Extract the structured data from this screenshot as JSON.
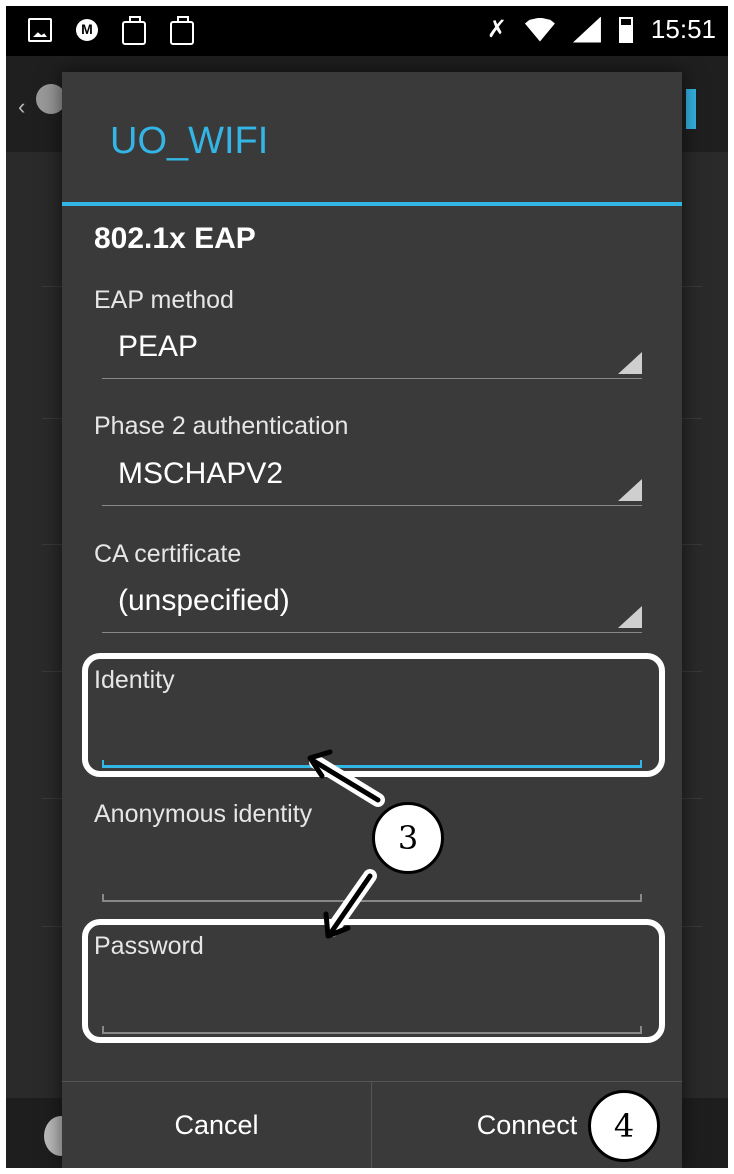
{
  "status_bar": {
    "time": "15:51",
    "left_icons": [
      "picture-icon",
      "motorola-icon",
      "briefcase-check-icon",
      "briefcase-icon"
    ],
    "right_icons": [
      "mute-icon",
      "wifi-icon",
      "signal-icon",
      "battery-icon"
    ]
  },
  "dialog": {
    "title": "UO_WIFI",
    "section": "802.1x EAP",
    "eap_method": {
      "label": "EAP method",
      "value": "PEAP"
    },
    "phase2": {
      "label": "Phase 2 authentication",
      "value": "MSCHAPV2"
    },
    "ca_cert": {
      "label": "CA certificate",
      "value": "(unspecified)"
    },
    "identity": {
      "label": "Identity",
      "value": ""
    },
    "anon_identity": {
      "label": "Anonymous identity",
      "value": ""
    },
    "password": {
      "label": "Password",
      "value": ""
    },
    "buttons": {
      "cancel": "Cancel",
      "connect": "Connect"
    }
  },
  "annotations": {
    "step3": "3",
    "step4": "4"
  },
  "colors": {
    "accent": "#33b5e5",
    "dialog_bg": "#3a3a3a",
    "annotation": "#ffffff"
  }
}
